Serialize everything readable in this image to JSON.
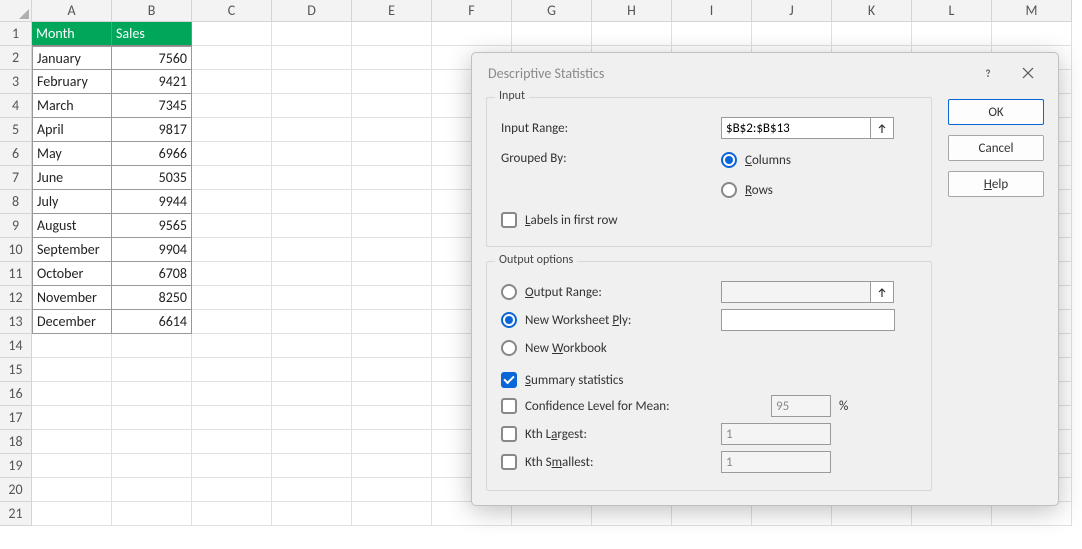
{
  "columns": [
    "A",
    "B",
    "C",
    "D",
    "E",
    "F",
    "G",
    "H",
    "I",
    "J",
    "K",
    "L",
    "M"
  ],
  "row_count": 21,
  "table": {
    "headers": [
      "Month",
      "Sales"
    ],
    "rows": [
      [
        "January",
        7560
      ],
      [
        "February",
        9421
      ],
      [
        "March",
        7345
      ],
      [
        "April",
        9817
      ],
      [
        "May",
        6966
      ],
      [
        "June",
        5035
      ],
      [
        "July",
        9944
      ],
      [
        "August",
        9565
      ],
      [
        "September",
        9904
      ],
      [
        "October",
        6708
      ],
      [
        "November",
        8250
      ],
      [
        "December",
        6614
      ]
    ]
  },
  "dialog": {
    "title": "Descriptive Statistics",
    "input": {
      "group_title": "Input",
      "input_range_label": "Input Range:",
      "input_range_value": "$B$2:$B$13",
      "grouped_by_label": "Grouped By:",
      "columns_label": "Columns",
      "rows_label": "Rows",
      "grouped_by_u1": "C",
      "grouped_by_u2": "R",
      "labels_first_row_label": "Labels in first row",
      "labels_first_row_u": "L",
      "labels_checked": false,
      "grouped_selected": "columns"
    },
    "output": {
      "group_title": "Output options",
      "output_range_label": "Output Range:",
      "output_range_u": "O",
      "worksheet_ply_label": "New Worksheet Ply:",
      "worksheet_ply_u": "P",
      "workbook_label": "New Workbook",
      "workbook_u": "W",
      "selected": "worksheet",
      "output_range_value": "",
      "worksheet_value": "",
      "summary_label": "Summary statistics",
      "summary_u": "S",
      "summary_checked": true,
      "confidence_label": "Confidence Level for Mean:",
      "confidence_checked": false,
      "confidence_value": "95",
      "confidence_suffix": "%",
      "kth_largest_label": "Kth Largest:",
      "kth_largest_u": "a",
      "kth_largest_checked": false,
      "kth_largest_value": "1",
      "kth_smallest_label": "Kth Smallest:",
      "kth_smallest_u": "m",
      "kth_smallest_checked": false,
      "kth_smallest_value": "1"
    },
    "buttons": {
      "ok": "OK",
      "cancel": "Cancel",
      "help": "Help",
      "help_u": "H"
    }
  }
}
